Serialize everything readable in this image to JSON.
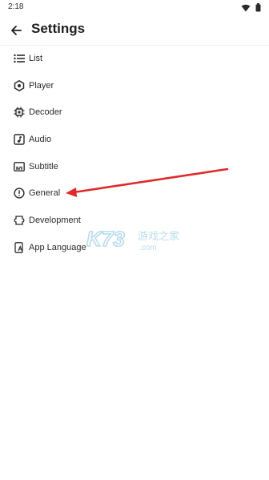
{
  "status": {
    "time": "2:18"
  },
  "header": {
    "title": "Settings"
  },
  "menu": {
    "items": [
      {
        "label": "List",
        "icon": "list-icon"
      },
      {
        "label": "Player",
        "icon": "player-icon"
      },
      {
        "label": "Decoder",
        "icon": "chip-icon"
      },
      {
        "label": "Audio",
        "icon": "music-icon"
      },
      {
        "label": "Subtitle",
        "icon": "subtitle-icon"
      },
      {
        "label": "General",
        "icon": "info-icon"
      },
      {
        "label": "Development",
        "icon": "development-icon"
      },
      {
        "label": "App Language",
        "icon": "language-icon"
      }
    ]
  },
  "colors": {
    "accent": "#e02a2a",
    "watermark": "#b8dced"
  },
  "watermark": {
    "brand": "K73",
    "text": "游戏之家",
    "sub": ".com"
  }
}
